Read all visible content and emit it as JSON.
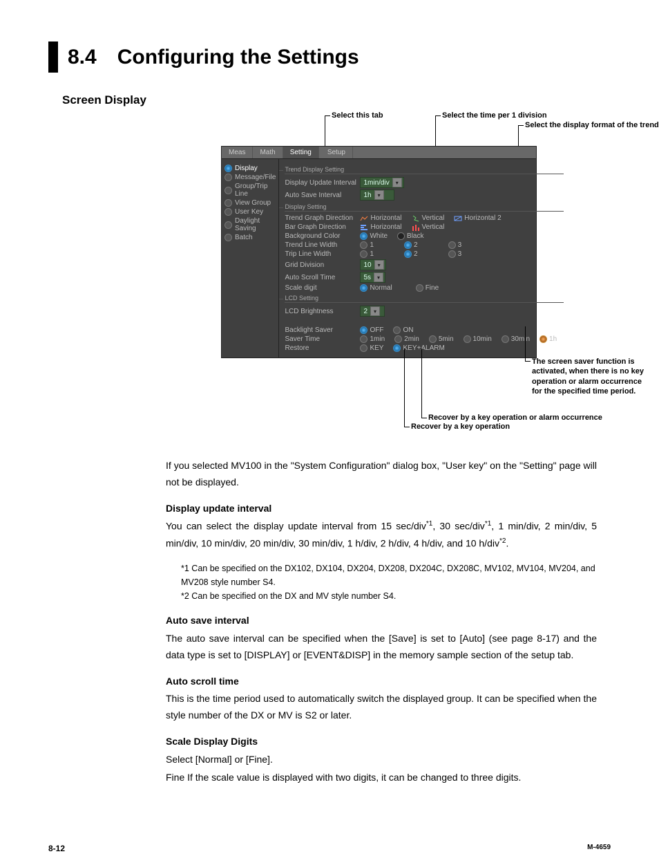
{
  "title": {
    "number": "8.4",
    "text": "Configuring the Settings"
  },
  "subheading": "Screen Display",
  "callouts": {
    "selectTab": "Select this tab",
    "selectTime": "Select the time per 1 division",
    "selectFormat": "Select the display format of the trend and bar graph",
    "saverFunc": "The screen saver function is activated, when there is no key operation or alarm occurrence for the specified time period.",
    "recoverKeyAlarm": "Recover by a key operation or alarm occurrence",
    "recoverKey": "Recover by a key operation"
  },
  "tabs": {
    "meas": "Meas",
    "math": "Math",
    "setting": "Setting",
    "setup": "Setup"
  },
  "sidebar": {
    "display": "Display",
    "messageFile": "Message/File",
    "groupTrip": "Group/Trip Line",
    "viewGroup": "View Group",
    "userKey": "User Key",
    "daylight": "Daylight Saving",
    "batch": "Batch"
  },
  "groups": {
    "trendDisplay": "Trend Display Setting",
    "display": "Display Setting",
    "lcd": "LCD Setting"
  },
  "labels": {
    "updateInterval": "Display Update Interval",
    "autoSave": "Auto Save Interval",
    "trendDir": "Trend Graph Direction",
    "barDir": "Bar Graph Direction",
    "bgColor": "Background Color",
    "trendLineW": "Trend Line Width",
    "tripLineW": "Trip Line Width",
    "gridDiv": "Grid Division",
    "autoScroll": "Auto Scroll Time",
    "scaleDigit": "Scale digit",
    "lcdBright": "LCD Brightness",
    "backlight": "Backlight Saver",
    "saverTime": "Saver Time",
    "restore": "Restore"
  },
  "values": {
    "updateInterval": "1min/div",
    "autoSave": "1h",
    "gridDiv": "10",
    "autoScroll": "5s",
    "lcdBright": "2"
  },
  "opts": {
    "horizontal": "Horizontal",
    "vertical": "Vertical",
    "horizontal2": "Horizontal 2",
    "white": "White",
    "black": "Black",
    "n1": "1",
    "n2": "2",
    "n3": "3",
    "normal": "Normal",
    "fine": "Fine",
    "off": "OFF",
    "on": "ON",
    "t1m": "1min",
    "t2m": "2min",
    "t5m": "5min",
    "t10m": "10min",
    "t30m": "30min",
    "t1h": "1h",
    "key": "KEY",
    "keyAlarm": "KEY+ALARM"
  },
  "para": {
    "intro": "If you selected MV100 in the \"System Configuration\" dialog box, \"User key\" on the \"Setting\" page will not be displayed.",
    "dui_h": "Display update interval",
    "dui_p1a": "You can select the display update interval from 15 sec/div",
    "dui_p1b": ", 30 sec/div",
    "dui_p1c": ", 1 min/div, 2 min/div, 5 min/div, 10 min/div, 20 min/div, 30 min/div, 1 h/div, 2 h/div, 4 h/div, and 10 h/div",
    "dui_p1d": ".",
    "fn1": "*1  Can be specified on the DX102, DX104, DX204, DX208, DX204C, DX208C, MV102, MV104, MV204, and MV208 style number S4.",
    "fn2": "*2  Can be specified on the DX and MV style number S4.",
    "asi_h": "Auto save interval",
    "asi_p": "The auto save interval can be specified when the [Save] is set to [Auto] (see page 8-17) and the data type is set to [DISPLAY] or [EVENT&DISP] in the memory sample section of the setup tab.",
    "ast_h": "Auto scroll time",
    "ast_p": "This is the time period used to automatically switch the displayed group.  It can be specified when the style number of the DX or MV is S2 or later.",
    "sdd_h": "Scale Display Digits",
    "sdd_p1": "Select [Normal] or [Fine].",
    "sdd_p2": "Fine  If the scale value is displayed with two digits, it can be changed to three digits."
  },
  "footer": {
    "pageNum": "8-12",
    "docId": "M-4659"
  }
}
